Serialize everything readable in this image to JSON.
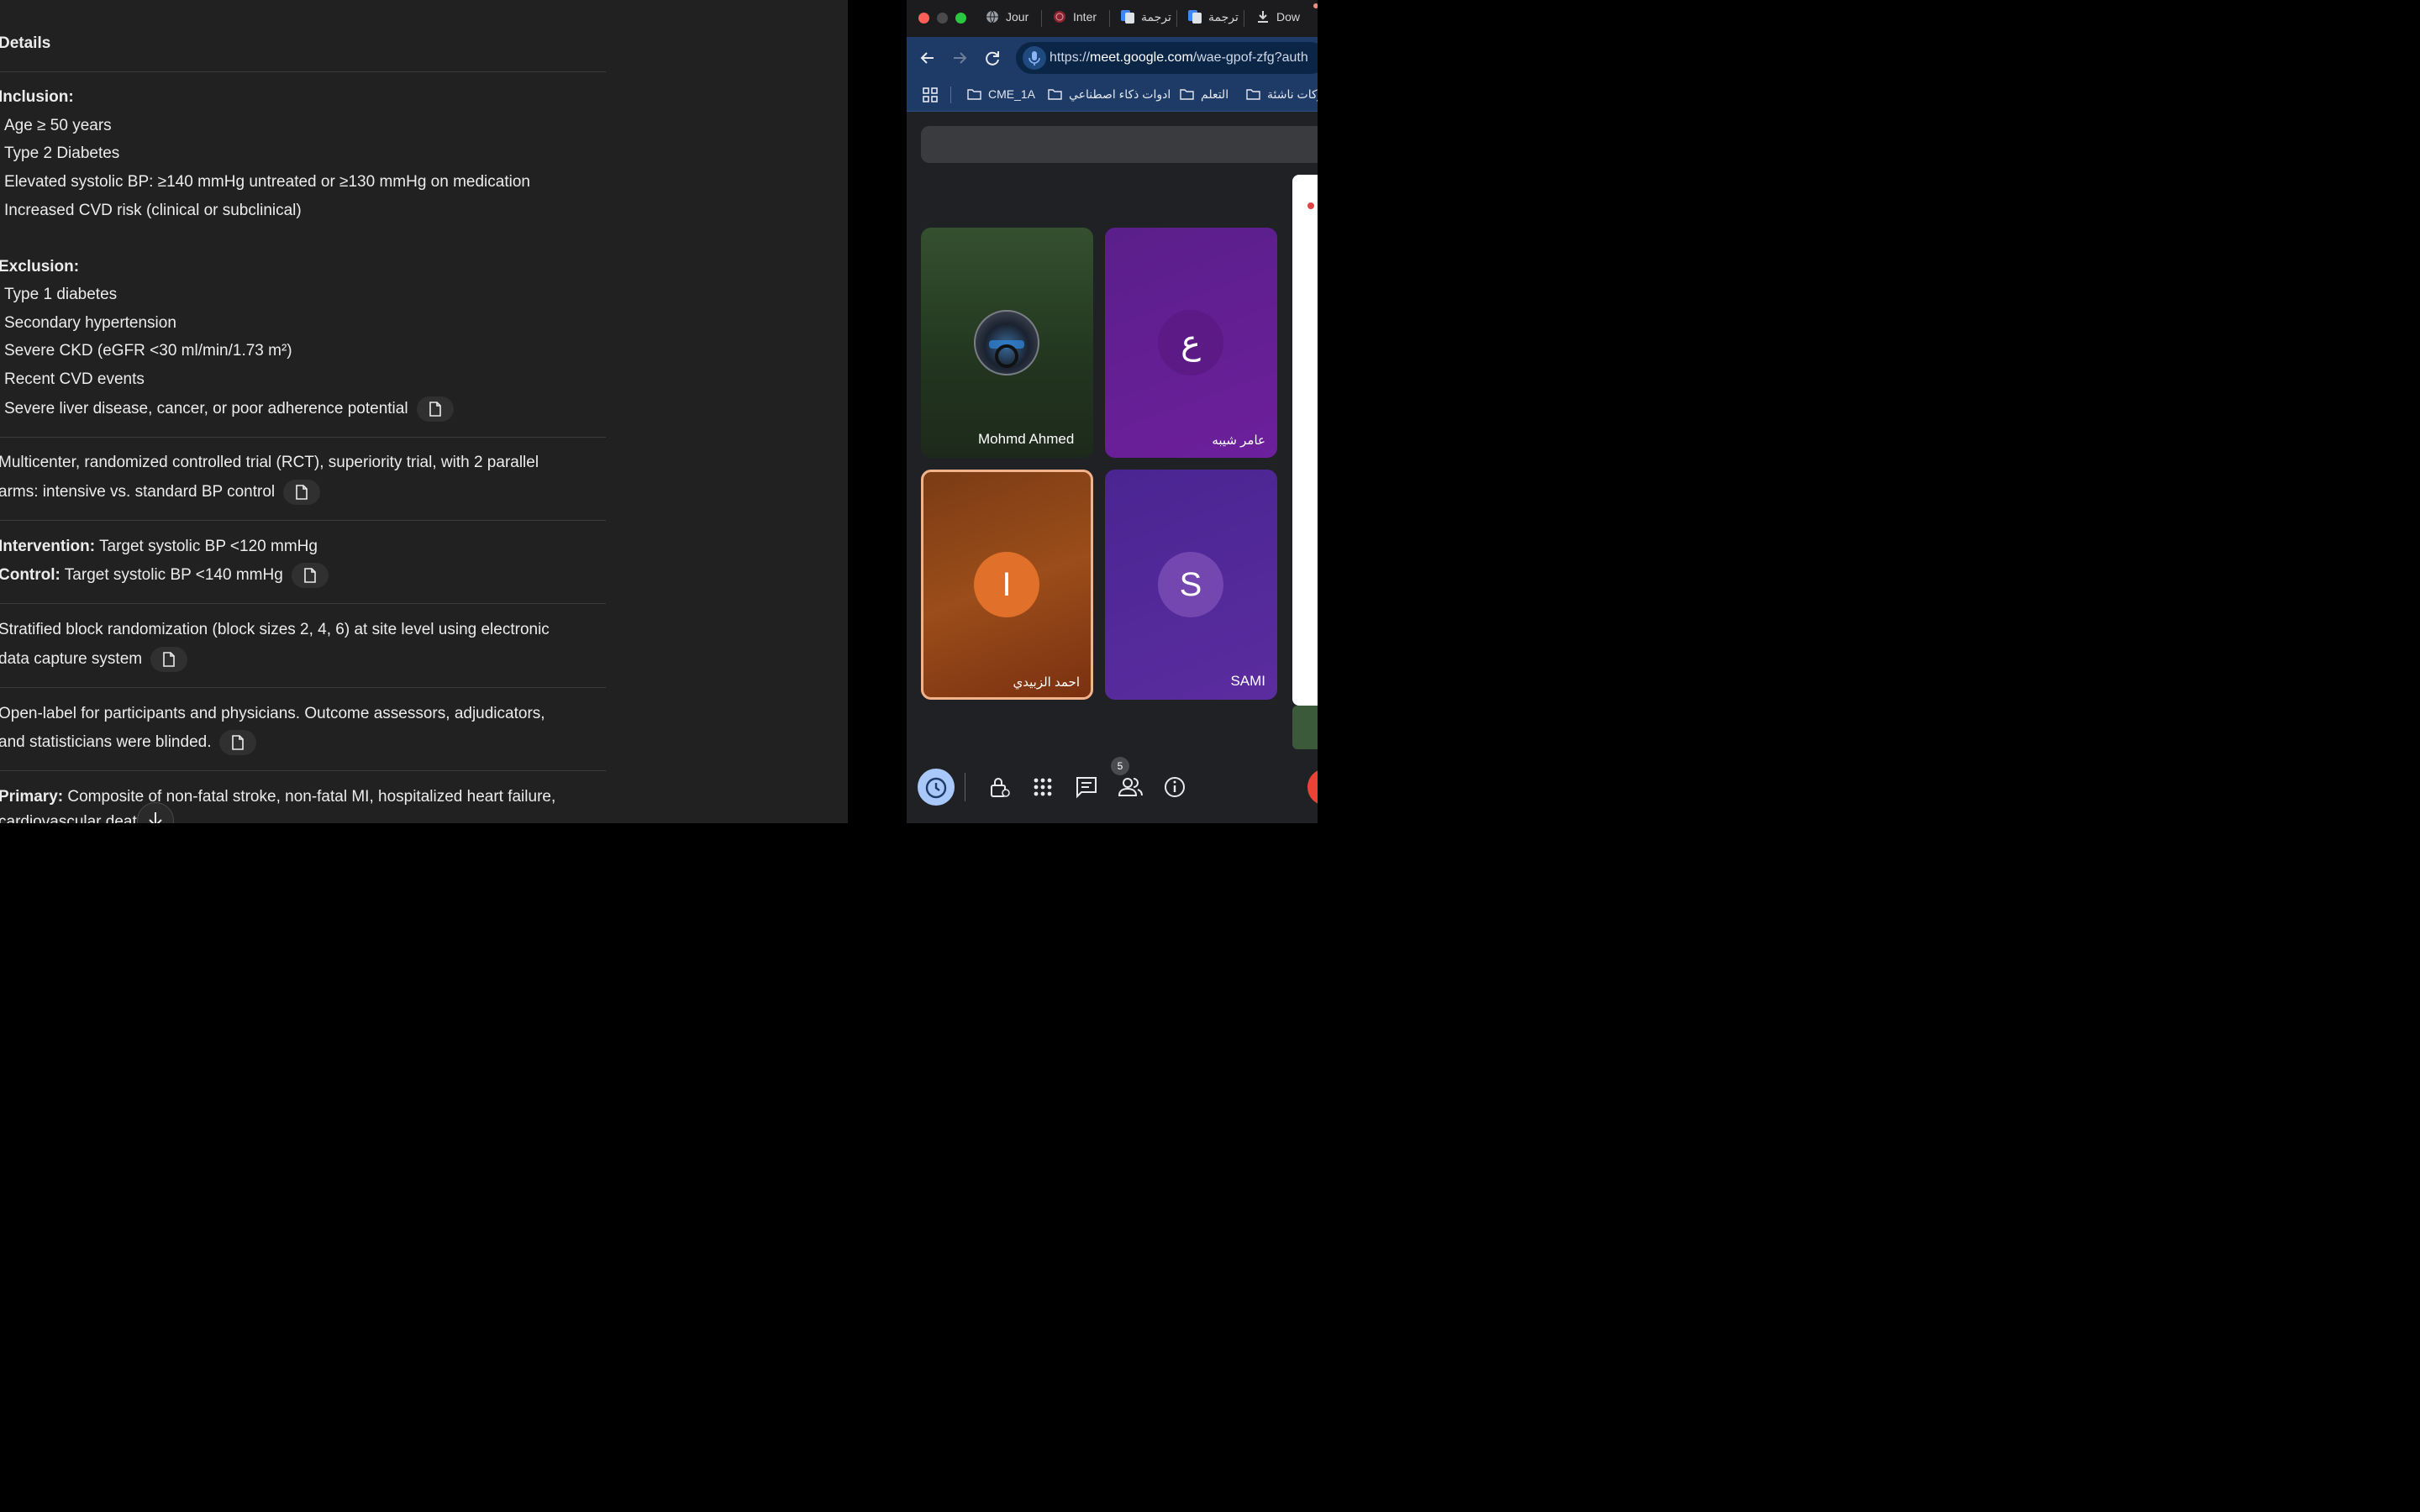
{
  "doc": {
    "title": "Details",
    "inclusion": {
      "heading": "Inclusion:",
      "items": [
        "Age ≥ 50 years",
        "Type 2 Diabetes",
        "Elevated systolic BP: ≥140 mmHg untreated or ≥130 mmHg on medication",
        "Increased CVD risk (clinical or subclinical)"
      ]
    },
    "exclusion": {
      "heading": "Exclusion:",
      "items": [
        "Type 1 diabetes",
        "Secondary hypertension",
        "Severe CKD (eGFR <30 ml/min/1.73 m²)",
        "Recent CVD events",
        "Severe liver disease, cancer, or poor adherence potential"
      ]
    },
    "design": {
      "line1": "Multicenter, randomized controlled trial (RCT), superiority trial, with 2 parallel",
      "line2": "arms: intensive vs. standard BP control"
    },
    "arms": {
      "intervention_label": "Intervention:",
      "intervention_text": " Target systolic BP <120 mmHg",
      "control_label": "Control:",
      "control_text": " Target systolic BP <140 mmHg"
    },
    "randomization": {
      "line1": "Stratified block randomization (block sizes 2, 4, 6) at site level using electronic",
      "line2": "data capture system"
    },
    "blinding": {
      "line1": "Open-label for participants and physicians. Outcome assessors, adjudicators,",
      "line2": "and statisticians were blinded."
    },
    "outcome": {
      "label": "Primary:",
      "line1": " Composite of non-fatal stroke, non-fatal MI, hospitalized heart failure,",
      "line2": "cardiovascular death"
    }
  },
  "browser": {
    "tabs": [
      "Jour",
      "Inter",
      "ترجمة",
      "ترجمة",
      "Dow"
    ],
    "url_prefix": "https://",
    "url_host": "meet.google.com",
    "url_path": "/wae-gpof-zfg?auth",
    "bookmarks": [
      "CME_1A",
      "ادوات ذكاء اصطناعي",
      "التعلم",
      "ركات ناشئة"
    ]
  },
  "meet": {
    "participants": [
      {
        "name": "Mohmd Ahmed",
        "initial": ""
      },
      {
        "name": "عامر شيبه",
        "initial": "ع"
      },
      {
        "name": "احمد الزبيدي",
        "initial": "I"
      },
      {
        "name": "SAMI",
        "initial": "S"
      }
    ],
    "people_count": "5"
  },
  "colors": {
    "doc_bg": "#212121",
    "tile_green": "#2d4a2b",
    "tile_purple": "#6a1b9a",
    "tile_orange": "#a0522d",
    "tile_violet": "#5b2c9f",
    "accent_blue": "#8ab4f8"
  }
}
